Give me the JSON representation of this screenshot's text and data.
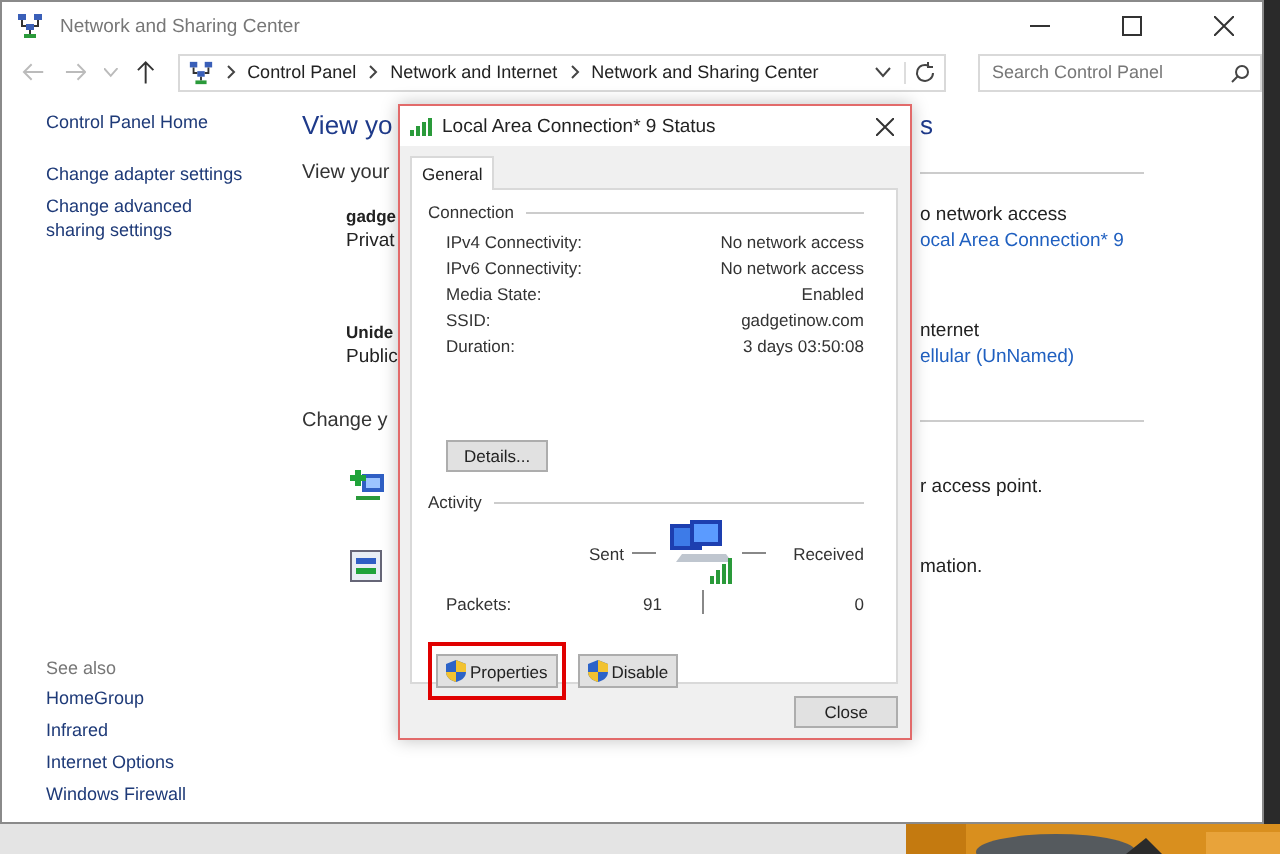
{
  "window": {
    "title": "Network and Sharing Center"
  },
  "address_bar": {
    "path": [
      "Control Panel",
      "Network and Internet",
      "Network and Sharing Center"
    ]
  },
  "search": {
    "placeholder": "Search Control Panel"
  },
  "sidebar": {
    "items": [
      "Control Panel Home",
      "Change adapter settings",
      "Change advanced sharing settings"
    ],
    "see_also_heading": "See also",
    "see_also": [
      "HomeGroup",
      "Infrared",
      "Internet Options",
      "Windows Firewall"
    ]
  },
  "main_rows": [
    {
      "kind": "heading",
      "left": "View yo",
      "right": "s"
    },
    {
      "kind": "section",
      "left": "View your"
    },
    {
      "kind": "name",
      "left": "gadge",
      "right": "o network access"
    },
    {
      "kind": "type",
      "left": "Privat",
      "right": "ocal Area Connection* 9",
      "right_link": true
    },
    {
      "kind": "name",
      "left": "Unide",
      "right": "nternet"
    },
    {
      "kind": "type",
      "left": "Public",
      "right": "ellular (UnNamed)",
      "right_link": true
    },
    {
      "kind": "section",
      "left": "Change y"
    },
    {
      "kind": "connect",
      "right": "r access point."
    },
    {
      "kind": "troubleshoot",
      "right": "mation."
    }
  ],
  "dialog": {
    "title": "Local Area Connection* 9 Status",
    "tabs": [
      {
        "label": "General",
        "selected": true
      }
    ],
    "connection_heading": "Connection",
    "connection_rows": [
      {
        "label": "IPv4 Connectivity:",
        "value": "No network access"
      },
      {
        "label": "IPv6 Connectivity:",
        "value": "No network access"
      },
      {
        "label": "Media State:",
        "value": "Enabled"
      },
      {
        "label": "SSID:",
        "value": "gadgetinow.com"
      },
      {
        "label": "Duration:",
        "value": "3 days 03:50:08"
      }
    ],
    "details_button": "Details...",
    "activity_heading": "Activity",
    "sent_label": "Sent",
    "received_label": "Received",
    "packets_label": "Packets:",
    "packets_sent": "91",
    "packets_received": "0",
    "buttons": [
      {
        "label": "Properties",
        "highlighted": true
      },
      {
        "label": "Disable",
        "highlighted": false
      }
    ],
    "close_button": "Close"
  }
}
